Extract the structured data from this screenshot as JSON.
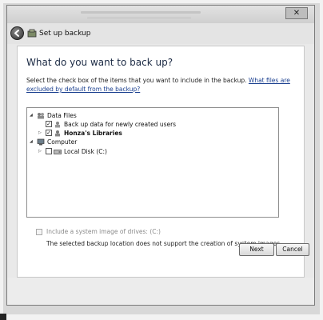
{
  "header": {
    "title": "Set up backup"
  },
  "main": {
    "heading": "What do you want to back up?",
    "instruction": "Select the check box of the items that you want to include in the backup.",
    "link_text": "What files are excluded by default from the backup?"
  },
  "tree": {
    "items": [
      {
        "label": "Data Files",
        "checked": null,
        "expanded": true
      },
      {
        "label": "Back up data for newly created users",
        "checked": true
      },
      {
        "label": "Honza's Libraries",
        "checked": true,
        "expanded": false
      },
      {
        "label": "Computer",
        "checked": null,
        "expanded": true
      },
      {
        "label": "Local Disk (C:)",
        "checked": false,
        "expanded": false
      }
    ]
  },
  "system_image": {
    "label": "Include a system image of drives: (C:)",
    "checked": false,
    "enabled": false,
    "note": "The selected backup location does not support the creation of system images."
  },
  "buttons": {
    "next": "Next",
    "cancel": "Cancel"
  },
  "titlebar": {
    "close_icon": "close-icon"
  }
}
